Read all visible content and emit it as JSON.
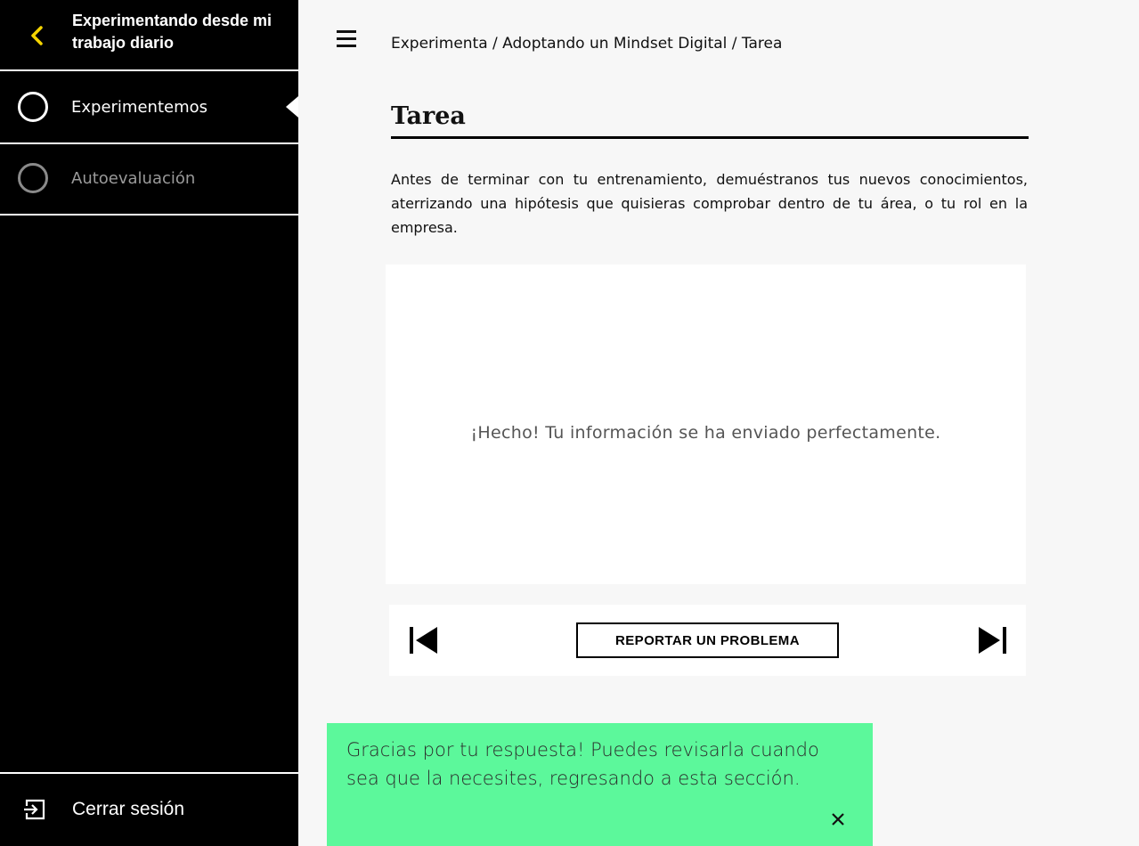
{
  "sidebar": {
    "title": "Experimentando desde mi trabajo diario",
    "back_icon": "chevron-left-icon",
    "items": [
      {
        "label": "Experimentemos",
        "state": "active"
      },
      {
        "label": "Autoevaluación",
        "state": "inactive"
      }
    ],
    "logout_label": "Cerrar sesión",
    "logout_icon": "logout-icon",
    "accent_color": "#f5d400"
  },
  "header": {
    "menu_icon": "hamburger-icon",
    "breadcrumb": "Experimenta / Adoptando un Mindset Digital / Tarea"
  },
  "main": {
    "title": "Tarea",
    "intro": "Antes de terminar con tu entrenamiento, demuéstranos tus nuevos conocimientos, aterrizando una hipótesis que quisieras comprobar dentro de tu área, o tu rol en la empresa.",
    "form_message": "¡Hecho! Tu información se ha enviado perfectamente.",
    "nav": {
      "prev_icon": "skip-previous-icon",
      "next_icon": "skip-next-icon",
      "report_label": "REPORTAR UN PROBLEMA"
    }
  },
  "toast": {
    "message": "Gracias por tu respuesta! Puedes revisarla cuando sea que la necesites, regresando a esta sección.",
    "close_icon": "close-icon",
    "color": "#5cf89b"
  }
}
